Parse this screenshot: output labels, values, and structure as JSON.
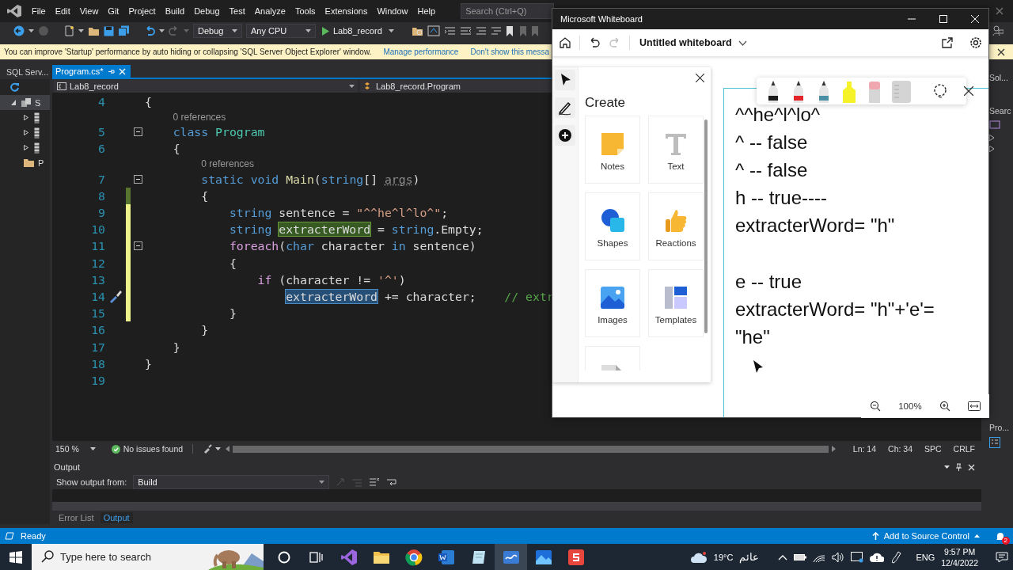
{
  "vs": {
    "menu": [
      "File",
      "Edit",
      "View",
      "Git",
      "Project",
      "Build",
      "Debug",
      "Test",
      "Analyze",
      "Tools",
      "Extensions",
      "Window",
      "Help"
    ],
    "search": {
      "placeholder": "Search (Ctrl+Q)"
    },
    "toolbar": {
      "configuration": "Debug",
      "platform": "Any CPU",
      "start": "Lab8_record"
    },
    "info_bar": {
      "message": "You can improve 'Startup' performance by auto hiding or collapsing 'SQL Server Object Explorer' window.",
      "links": [
        "Manage performance",
        "Don't show this messa"
      ]
    },
    "side_panel": {
      "title": "SQL Serv...",
      "tree": [
        {
          "label": "S",
          "kind": "server",
          "expanded": true,
          "selected": true,
          "children": [
            {
              "kind": "database",
              "expanded": false,
              "selected": false
            },
            {
              "kind": "database",
              "expanded": false,
              "selected": false
            },
            {
              "kind": "database",
              "expanded": false,
              "selected": false
            },
            {
              "label": "P",
              "kind": "folder",
              "selected": false
            }
          ]
        }
      ]
    },
    "editor": {
      "tabs": [
        {
          "label": "Program.cs*",
          "selected": true
        }
      ],
      "project": "Lab8_record",
      "scope": "Lab8_record.Program",
      "lines": [
        {
          "number": "4",
          "modified": false,
          "foldable": false,
          "quick_action": false,
          "tokens": [
            {
              "text": "{",
              "kind": "plain"
            }
          ]
        },
        {
          "number": "5",
          "lens": "0 references",
          "modified": false,
          "foldable": true,
          "quick_action": false,
          "tokens": [
            {
              "text": "    class",
              "kind": "keyword"
            },
            {
              "text": " Program",
              "kind": "type"
            }
          ]
        },
        {
          "number": "6",
          "modified": false,
          "foldable": false,
          "quick_action": false,
          "tokens": [
            {
              "text": "    {",
              "kind": "plain"
            }
          ]
        },
        {
          "number": "7",
          "lens": "0 references",
          "modified": false,
          "foldable": true,
          "quick_action": false,
          "tokens": [
            {
              "text": "        static void",
              "kind": "keyword"
            },
            {
              "text": " Main",
              "kind": "method"
            },
            {
              "text": "(",
              "kind": "plain"
            },
            {
              "text": "string",
              "kind": "keyword"
            },
            {
              "text": "[] ",
              "kind": "plain"
            },
            {
              "text": "args",
              "kind": "unused"
            },
            {
              "text": ")",
              "kind": "plain"
            }
          ]
        },
        {
          "number": "8",
          "modified": true,
          "saved": true,
          "foldable": false,
          "quick_action": false,
          "tokens": [
            {
              "text": "        {",
              "kind": "plain"
            }
          ]
        },
        {
          "number": "9",
          "modified": true,
          "saved": false,
          "foldable": false,
          "quick_action": false,
          "tokens": [
            {
              "text": "            string",
              "kind": "keyword"
            },
            {
              "text": " sentence = ",
              "kind": "plain"
            },
            {
              "text": "\"^^he^l^lo^\"",
              "kind": "string"
            },
            {
              "text": ";",
              "kind": "plain"
            }
          ]
        },
        {
          "number": "10",
          "modified": true,
          "saved": false,
          "foldable": false,
          "quick_action": false,
          "tokens": [
            {
              "text": "            string",
              "kind": "keyword"
            },
            {
              "text": " extracterWord",
              "kind": "definition"
            },
            {
              "text": " = ",
              "kind": "plain"
            },
            {
              "text": "string",
              "kind": "keyword"
            },
            {
              "text": ".Empty;",
              "kind": "plain"
            }
          ]
        },
        {
          "number": "11",
          "modified": true,
          "saved": false,
          "foldable": true,
          "quick_action": false,
          "tokens": [
            {
              "text": "            foreach",
              "kind": "control"
            },
            {
              "text": "(",
              "kind": "plain"
            },
            {
              "text": "char",
              "kind": "keyword"
            },
            {
              "text": " character ",
              "kind": "plain"
            },
            {
              "text": "in",
              "kind": "keyword"
            },
            {
              "text": " sentence)",
              "kind": "plain"
            }
          ]
        },
        {
          "number": "12",
          "modified": true,
          "saved": false,
          "foldable": false,
          "quick_action": false,
          "tokens": [
            {
              "text": "            {",
              "kind": "plain"
            }
          ]
        },
        {
          "number": "13",
          "modified": true,
          "saved": false,
          "foldable": false,
          "quick_action": false,
          "tokens": [
            {
              "text": "                if",
              "kind": "control"
            },
            {
              "text": " (character != ",
              "kind": "plain"
            },
            {
              "text": "'^'",
              "kind": "string"
            },
            {
              "text": ")",
              "kind": "plain"
            }
          ]
        },
        {
          "number": "14",
          "modified": true,
          "saved": false,
          "foldable": false,
          "quick_action": true,
          "tokens": [
            {
              "text": "                    extracterWord",
              "kind": "reference"
            },
            {
              "text": " += character;    ",
              "kind": "plain"
            },
            {
              "text": "// extr",
              "kind": "comment"
            }
          ]
        },
        {
          "number": "15",
          "modified": true,
          "saved": false,
          "foldable": false,
          "quick_action": false,
          "tokens": [
            {
              "text": "            }",
              "kind": "plain"
            }
          ]
        },
        {
          "number": "16",
          "modified": false,
          "foldable": false,
          "quick_action": false,
          "tokens": [
            {
              "text": "        }",
              "kind": "plain"
            }
          ]
        },
        {
          "number": "17",
          "modified": false,
          "foldable": false,
          "quick_action": false,
          "tokens": [
            {
              "text": "    }",
              "kind": "plain"
            }
          ]
        },
        {
          "number": "18",
          "modified": false,
          "foldable": false,
          "quick_action": false,
          "tokens": [
            {
              "text": "}",
              "kind": "plain"
            }
          ]
        },
        {
          "number": "19",
          "modified": false,
          "foldable": false,
          "quick_action": false
        }
      ],
      "zoom": "150 %",
      "issues": "No issues found",
      "caret": [
        "Ln: 14",
        "Ch: 34",
        "SPC",
        "CRLF"
      ]
    },
    "output": {
      "title": "Output",
      "source_label": "Show output from:",
      "source": "Build"
    },
    "panel_tabs": [
      {
        "label": "Error List",
        "selected": false
      },
      {
        "label": "Output",
        "selected": true
      }
    ],
    "side_tabs": [
      "Sol...",
      "Searc",
      "Pro..."
    ],
    "status": {
      "text": "Ready",
      "source_control": "Add to Source Control",
      "notifications": "2"
    }
  },
  "whiteboard": {
    "title": "Microsoft Whiteboard",
    "board_name": "Untitled whiteboard",
    "tools": [
      {
        "kind": "select"
      },
      {
        "kind": "pen"
      },
      {
        "kind": "add"
      }
    ],
    "create": {
      "title": "Create",
      "items": [
        {
          "label": "Notes",
          "kind": "notes"
        },
        {
          "label": "Text",
          "kind": "text"
        },
        {
          "label": "Shapes",
          "kind": "shapes"
        },
        {
          "label": "Reactions",
          "kind": "reactions"
        },
        {
          "label": "Images",
          "kind": "images"
        },
        {
          "label": "Templates",
          "kind": "templates"
        },
        {
          "kind": "document"
        }
      ]
    },
    "pens": [
      {
        "kind": "pen",
        "color": "#1a1a1a"
      },
      {
        "kind": "pen",
        "color": "#e3242b"
      },
      {
        "kind": "pen",
        "color": "#4a8fa3"
      },
      {
        "kind": "highlighter",
        "color": "#f5f22a"
      },
      {
        "kind": "eraser",
        "color": "#f0a8b0"
      },
      {
        "kind": "ruler",
        "color": "#d4d4d4"
      },
      {
        "kind": "lasso"
      }
    ],
    "ink": [
      {
        "lines": [
          "^^he^l^lo^",
          "^ -- false",
          "^ -- false",
          "h -- true----",
          "extracterWord= \"h\""
        ]
      },
      {
        "lines": [
          "e -- true",
          "extracterWord= \"h\"+'e'=",
          "\"he\""
        ]
      }
    ],
    "zoom": "100%"
  },
  "taskbar": {
    "search": {
      "placeholder": "Type here to search"
    },
    "apps": [
      {
        "kind": "cortana",
        "selected": false
      },
      {
        "kind": "task-view",
        "selected": false
      },
      {
        "kind": "visual-studio",
        "selected": false
      },
      {
        "kind": "explorer",
        "selected": false
      },
      {
        "kind": "chrome",
        "selected": false
      },
      {
        "kind": "word",
        "selected": false
      },
      {
        "kind": "notepad",
        "selected": false
      },
      {
        "kind": "whiteboard",
        "selected": true
      },
      {
        "kind": "photos",
        "selected": false
      },
      {
        "kind": "slides",
        "selected": false
      }
    ],
    "weather": {
      "temperature": "19°C",
      "condition": "عائم"
    },
    "language": "ENG",
    "time": "9:57 PM",
    "date": "12/4/2022"
  }
}
